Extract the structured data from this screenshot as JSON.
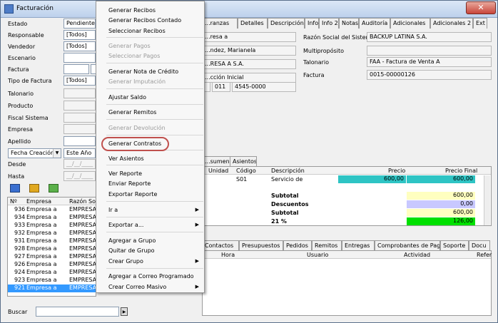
{
  "window": {
    "title": "Facturación"
  },
  "form": {
    "estado_label": "Estado",
    "estado_value": "Pendiente",
    "responsable_label": "Responsable",
    "responsable_value": "[Todos]",
    "vendedor_label": "Vendedor",
    "vendedor_value": "[Todos]",
    "escenario_label": "Escenario",
    "factura_label": "Factura",
    "tipo_label": "Tipo de Factura",
    "tipo_value": "[Todos]",
    "talonario_label": "Talonario",
    "producto_label": "Producto",
    "fiscal_label": "Fiscal Sistema",
    "empresa_label": "Empresa",
    "apellido_label": "Apellido",
    "fecha_combo": "Fecha Creación",
    "fecha_period": "Este Año",
    "desde_label": "Desde",
    "desde_value": "__/__/____",
    "hasta_label": "Hasta",
    "hasta_value": "__/__/____",
    "buscar_label": "Buscar"
  },
  "list": {
    "headers": [
      "Nº",
      "Empresa",
      "Razón So"
    ],
    "rows": [
      {
        "num": "936",
        "empresa": "Empresa a",
        "razon": "EMPRESA"
      },
      {
        "num": "934",
        "empresa": "Empresa a",
        "razon": "EMPRESA"
      },
      {
        "num": "933",
        "empresa": "Empresa a",
        "razon": "EMPRESA"
      },
      {
        "num": "932",
        "empresa": "Empresa a",
        "razon": "EMPRESA"
      },
      {
        "num": "931",
        "empresa": "Empresa a",
        "razon": "EMPRESA"
      },
      {
        "num": "928",
        "empresa": "Empresa a",
        "razon": "EMPRESA"
      },
      {
        "num": "927",
        "empresa": "Empresa a",
        "razon": "EMPRESA"
      },
      {
        "num": "926",
        "empresa": "Empresa a",
        "razon": "EMPRESA"
      },
      {
        "num": "924",
        "empresa": "Empresa a",
        "razon": "EMPRESA"
      },
      {
        "num": "923",
        "empresa": "Empresa a",
        "razon": "EMPRESA"
      },
      {
        "num": "921",
        "empresa": "Empresa a",
        "razon": "EMPRESA"
      }
    ]
  },
  "menu": {
    "items": [
      "Generar Recibos",
      "Generar Recibos Contado",
      "Seleccionar Recibos",
      "Generar Pagos",
      "Seleccionar Pagos",
      "Generar Nota de Crédito",
      "Generar Imputación",
      "Ajustar Saldo",
      "Generar Remitos",
      "Generar Devolución",
      "Generar Contratos",
      "Ver Asientos",
      "Ver Reporte",
      "Enviar Reporte",
      "Exportar Reporte",
      "Ir a",
      "Exportar a...",
      "Agregar a Grupo",
      "Quitar de Grupo",
      "Crear Grupo",
      "Agregar a Correo Programado",
      "Crear Correo Masivo"
    ]
  },
  "tabs": {
    "items": [
      "...ranzas",
      "Detalles",
      "Descripción",
      "Info",
      "Info 2",
      "Notas",
      "Auditoría",
      "Adicionales",
      "Adicionales 2",
      "Ext"
    ]
  },
  "detail": {
    "empresa_frag": "...resa a",
    "contacto_frag": "...ndez, Marianela",
    "razon_frag": "...RESA A S.A.",
    "ubic_frag": "...cción Inicial",
    "num1": "011",
    "num2": "4545-0000",
    "razon_sistema_label": "Razón Social del Sistema",
    "razon_sistema_value": "BACKUP LATINA S.A.",
    "multiproposito_label": "Multipropósito",
    "talonario_label": "Talonario",
    "talonario_value": "FAA - Factura de Venta A",
    "factura_label": "Factura",
    "factura_value": "0015-00000126"
  },
  "items_tabs": [
    "...sumen",
    "Asientos"
  ],
  "items_grid": {
    "headers": [
      "Unidad",
      "Código",
      "Descripción",
      "Precio",
      "Precio Final"
    ],
    "row": {
      "codigo": "S01",
      "descripcion": "Servicio de",
      "precio": "600,00",
      "final": "600,00"
    },
    "totals": [
      {
        "label": "Subtotal",
        "value": "600,00"
      },
      {
        "label": "Descuentos",
        "value": "0,00"
      },
      {
        "label": "Subtotal",
        "value": "600,00"
      },
      {
        "label": "21 %",
        "value": "126,00"
      }
    ]
  },
  "bottom_tabs": [
    "Contactos",
    "Presupuestos",
    "Pedidos",
    "Remitos",
    "Entregas",
    "Comprobantes de Pago",
    "Soporte",
    "Docu"
  ],
  "bottom_grid": {
    "headers": [
      "Hora",
      "Usuario",
      "Actividad",
      "Refer"
    ]
  },
  "colors": {
    "highlight": "#c0504d",
    "selection": "#3399ff",
    "teal": "#2ec4c4",
    "yellow": "#ffffc0",
    "lavender": "#c8c8ff",
    "green": "#00e000"
  }
}
